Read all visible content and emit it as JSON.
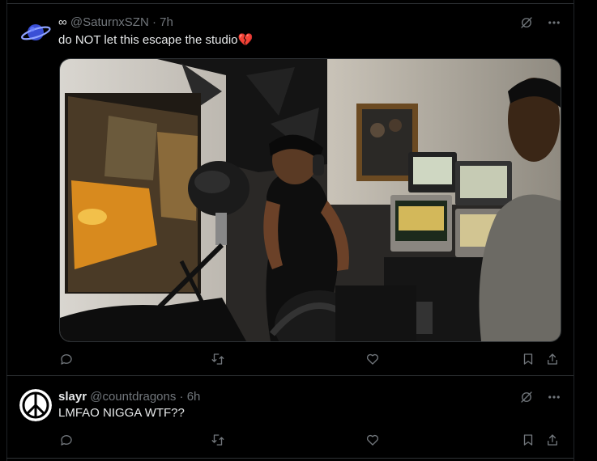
{
  "posts": [
    {
      "display_name": "∞",
      "handle": "@SaturnxSZN",
      "separator": "·",
      "time": "7h",
      "text": "do NOT let this escape the studio",
      "emoji": "💔",
      "avatar_icon": "saturn-planet-icon",
      "media": {
        "kind": "video-frame",
        "description_icon": "studio-photo"
      }
    },
    {
      "display_name": "slayr",
      "handle": "@countdragons",
      "separator": "·",
      "time": "6h",
      "text": "LMFAO NIGGA WTF??",
      "avatar_icon": "peace-sign-icon"
    }
  ],
  "actions": [
    "reply-icon",
    "repost-icon",
    "like-icon",
    "bookmark-icon",
    "share-icon"
  ],
  "colors": {
    "background": "#000000",
    "text": "#e7e9ea",
    "muted": "#71767b",
    "divider": "#2f3336"
  }
}
